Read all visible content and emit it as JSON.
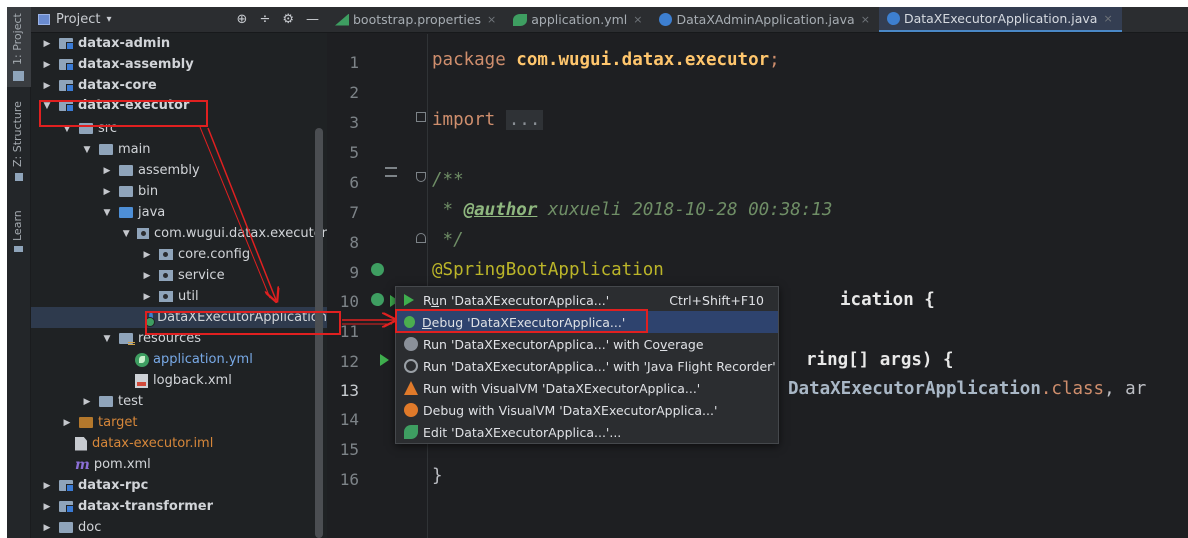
{
  "toolstrip": {
    "tabs": [
      {
        "label": "1: Project",
        "icon": "folder-icon"
      },
      {
        "label": "Z: Structure",
        "icon": "structure-icon"
      },
      {
        "label": "Learn",
        "icon": "learn-icon"
      }
    ]
  },
  "project_panel": {
    "title": "Project",
    "dropdown": "▾",
    "tools": [
      "⊕",
      "÷",
      "⚙",
      "—"
    ],
    "tree": [
      {
        "label": "datax-admin",
        "arrow": "▶",
        "kind": "module"
      },
      {
        "label": "datax-assembly",
        "arrow": "▶",
        "kind": "module"
      },
      {
        "label": "datax-core",
        "arrow": "▶",
        "kind": "module"
      },
      {
        "label": "datax-executor",
        "arrow": "▼",
        "kind": "module"
      },
      {
        "label": "src",
        "arrow": "▼",
        "kind": "folder"
      },
      {
        "label": "main",
        "arrow": "▼",
        "kind": "folder"
      },
      {
        "label": "assembly",
        "arrow": "▶",
        "kind": "folder"
      },
      {
        "label": "bin",
        "arrow": "▶",
        "kind": "folder"
      },
      {
        "label": "java",
        "arrow": "▼",
        "kind": "folder-blue"
      },
      {
        "label": "com.wugui.datax.executor",
        "arrow": "▼",
        "kind": "package"
      },
      {
        "label": "core.config",
        "arrow": "▶",
        "kind": "package"
      },
      {
        "label": "service",
        "arrow": "▶",
        "kind": "package"
      },
      {
        "label": "util",
        "arrow": "▶",
        "kind": "package"
      },
      {
        "label": "DataXExecutorApplication",
        "arrow": "",
        "kind": "class"
      },
      {
        "label": "resources",
        "arrow": "▼",
        "kind": "resources"
      },
      {
        "label": "application.yml",
        "arrow": "",
        "kind": "yml"
      },
      {
        "label": "logback.xml",
        "arrow": "",
        "kind": "xml"
      },
      {
        "label": "test",
        "arrow": "▶",
        "kind": "folder"
      },
      {
        "label": "target",
        "arrow": "▶",
        "kind": "folder-orange"
      },
      {
        "label": "datax-executor.iml",
        "arrow": "",
        "kind": "iml"
      },
      {
        "label": "pom.xml",
        "arrow": "",
        "kind": "pom"
      },
      {
        "label": "datax-rpc",
        "arrow": "▶",
        "kind": "module"
      },
      {
        "label": "datax-transformer",
        "arrow": "▶",
        "kind": "module"
      },
      {
        "label": "doc",
        "arrow": "▶",
        "kind": "folder"
      }
    ]
  },
  "tabs": [
    {
      "label": "bootstrap.properties",
      "icon": "spring-leaf-icon",
      "close": "×"
    },
    {
      "label": "application.yml",
      "icon": "spring-yml-icon",
      "close": "×"
    },
    {
      "label": "DataXAdminApplication.java",
      "icon": "spring-class-icon",
      "close": "×"
    },
    {
      "label": "DataXExecutorApplication.java",
      "icon": "spring-class-icon",
      "close": "×"
    }
  ],
  "editor": {
    "line_numbers": [
      "1",
      "2",
      "3",
      "5",
      "6",
      "7",
      "8",
      "9",
      "10",
      "11",
      "12",
      "13",
      "14",
      "15",
      "16"
    ],
    "code": {
      "l1_kw": "package ",
      "l1_pkg": "com.wugui.datax.executor",
      "l1_end": ";",
      "l3_kw": "import ",
      "l3_fold": "...",
      "l6": "/**",
      "l7_star": " * ",
      "l7_tag": "@author",
      "l7_text": " xuxueli 2018-10-28 00:38:13",
      "l8": " */",
      "l9": "@SpringBootApplication",
      "l10_tail": "ication {",
      "l12_tail": "ring[] args) {",
      "l13_cls": "DataXExecutorApplication",
      "l13_kw": ".class",
      "l13_rest": ", ar",
      "l16": "}"
    }
  },
  "context_menu": {
    "items": [
      {
        "label_pre": "R",
        "label_u": "u",
        "label_post": "n 'DataXExecutorApplica...'",
        "shortcut": "Ctrl+Shift+F10"
      },
      {
        "label_pre": "",
        "label_u": "D",
        "label_post": "ebug 'DataXExecutorApplica...'",
        "shortcut": ""
      },
      {
        "label_pre": "Run 'DataXExecutorApplica...' with Co",
        "label_u": "v",
        "label_post": "erage",
        "shortcut": ""
      },
      {
        "label_pre": "Run 'DataXExecutorApplica...' with 'Java Flight Recorder'",
        "label_u": "",
        "label_post": "",
        "shortcut": ""
      },
      {
        "label_pre": "Run with VisualVM 'DataXExecutorApplica...'",
        "label_u": "",
        "label_post": "",
        "shortcut": ""
      },
      {
        "label_pre": "Debug with VisualVM 'DataXExecutorApplica...'",
        "label_u": "",
        "label_post": "",
        "shortcut": ""
      },
      {
        "label_pre": "Edit 'DataXExecutorApplica...'...",
        "label_u": "",
        "label_post": "",
        "shortcut": ""
      }
    ]
  },
  "colors": {
    "annotation_red": "#e02020",
    "selection_blue": "#2e436e"
  }
}
